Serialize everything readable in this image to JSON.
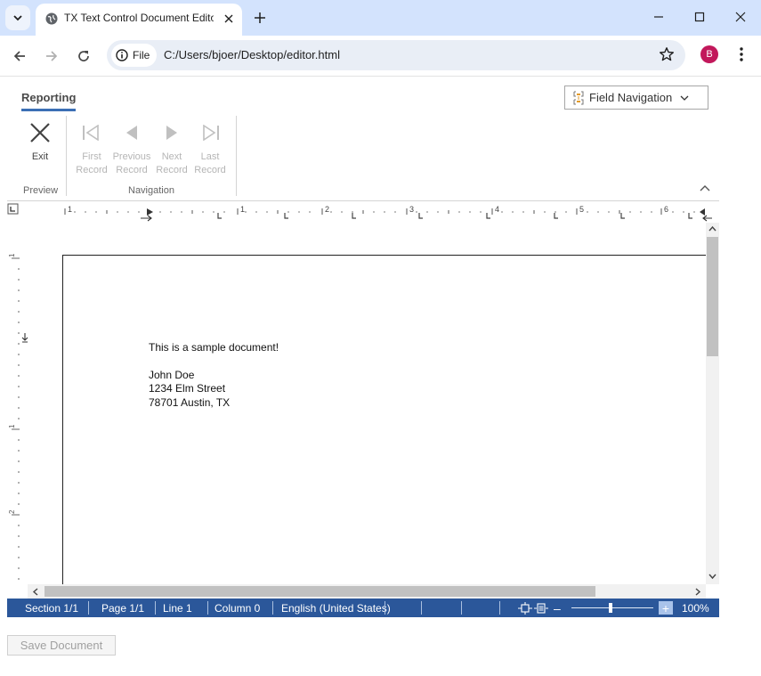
{
  "browser": {
    "tab_title": "TX Text Control Document Editor",
    "file_chip": "File",
    "url": "C:/Users/bjoer/Desktop/editor.html",
    "profile_initial": "B"
  },
  "ribbon": {
    "active_tab": "Reporting",
    "field_navigation": "Field Navigation",
    "buttons": [
      {
        "label1": "Exit",
        "label2": ""
      },
      {
        "label1": "First",
        "label2": "Record"
      },
      {
        "label1": "Previous",
        "label2": "Record"
      },
      {
        "label1": "Next",
        "label2": "Record"
      },
      {
        "label1": "Last",
        "label2": "Record"
      }
    ],
    "groups": {
      "preview": "Preview",
      "navigation": "Navigation"
    }
  },
  "ruler": {
    "h_numbers": [
      "1",
      "1",
      "2",
      "3",
      "4",
      "5",
      "6"
    ],
    "v_numbers": [
      "1",
      "1",
      "2"
    ]
  },
  "document": {
    "lines": [
      "This is a sample document!",
      "",
      "John Doe",
      "1234 Elm Street",
      "78701 Austin, TX"
    ]
  },
  "status": {
    "section": "Section 1/1",
    "page": "Page 1/1",
    "line": "Line 1",
    "column": "Column 0",
    "language": "English (United States)",
    "zoom_minus": "–",
    "zoom_plus": "+",
    "zoom": "100%",
    "zoom_level_percent": 100
  },
  "footer": {
    "save_label": "Save Document"
  },
  "colors": {
    "status_bar": "#2b579a",
    "tab_bar": "#d3e3fd",
    "ribbon_accent": "#3c6fb5"
  }
}
